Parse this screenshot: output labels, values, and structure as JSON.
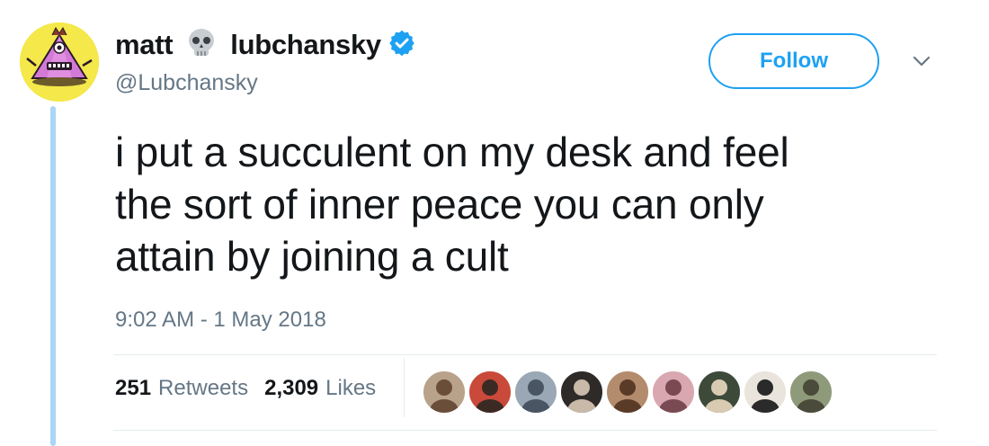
{
  "author": {
    "display_name_first": "matt",
    "display_name_last": "lubchansky",
    "handle": "@Lubchansky",
    "verified": true,
    "skull_emoji": "skull-icon"
  },
  "follow_button": {
    "label": "Follow",
    "color": "#1da1f2"
  },
  "tweet": {
    "text_lines": [
      "i put a succulent on my desk and feel",
      "the sort of inner peace you can only",
      "attain by joining a cult"
    ],
    "timestamp": "9:02 AM - 1 May 2018"
  },
  "stats": {
    "retweets_count": "251",
    "retweets_label": "Retweets",
    "likes_count": "2,309",
    "likes_label": "Likes"
  },
  "liker_avatars": [
    {
      "name": "liker-avatar-1",
      "bg": "#b9a28a",
      "fg": "#6b4e3a"
    },
    {
      "name": "liker-avatar-2",
      "bg": "#c94a3a",
      "fg": "#3b2a24"
    },
    {
      "name": "liker-avatar-3",
      "bg": "#9aa8b6",
      "fg": "#4a5563"
    },
    {
      "name": "liker-avatar-4",
      "bg": "#2e2a28",
      "fg": "#c8b9a8"
    },
    {
      "name": "liker-avatar-5",
      "bg": "#b38b6d",
      "fg": "#5a3b28"
    },
    {
      "name": "liker-avatar-6",
      "bg": "#d8a7b0",
      "fg": "#7a4a52"
    },
    {
      "name": "liker-avatar-7",
      "bg": "#3d4a3a",
      "fg": "#d9cbb2"
    },
    {
      "name": "liker-avatar-8",
      "bg": "#e9e4dc",
      "fg": "#2a2a2a"
    },
    {
      "name": "liker-avatar-9",
      "bg": "#8e9a7a",
      "fg": "#4a4b3a"
    }
  ],
  "colors": {
    "accent": "#1da1f2",
    "thread_line": "#a9d6f5",
    "secondary_text": "#657786",
    "avatar_bg": "#f4e84a"
  }
}
